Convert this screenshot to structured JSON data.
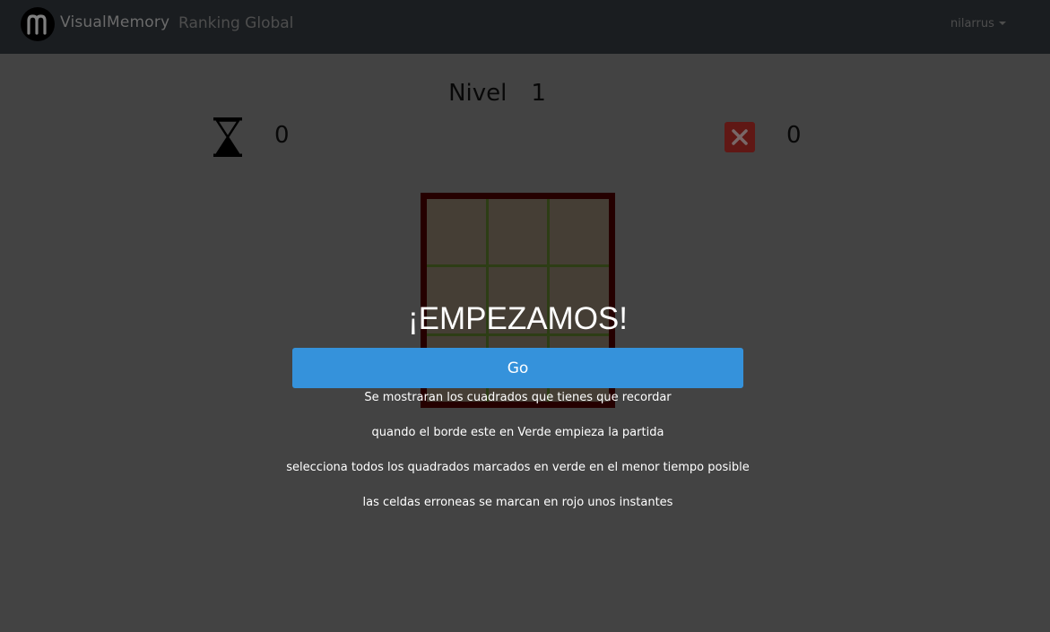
{
  "navbar": {
    "brand": "VisualMemory",
    "ranking_link": "Ranking Global",
    "user": "nilarrus"
  },
  "game": {
    "level_label": "Nivel",
    "level_value": "1",
    "time_value": "0",
    "errors_value": "0",
    "grid_size": 3
  },
  "overlay": {
    "headline": "¡EMPEZAMOS!",
    "go_button": "Go",
    "instructions": [
      "Se mostraran los cuadrados que tienes que recordar",
      "quando el borde este en Verde empieza la partida",
      "selecciona todos los quadrados marcados en verde en el menor tiempo posible",
      "las celdas erroneas se marcan en rojo unos instantes"
    ]
  },
  "colors": {
    "navbar": "#343a40",
    "button": "#3592db",
    "board_border": "#4a0000",
    "error_icon": "#c0302a"
  },
  "icons": [
    "logo-icon",
    "hourglass-icon",
    "close-icon",
    "chevron-down-icon"
  ]
}
